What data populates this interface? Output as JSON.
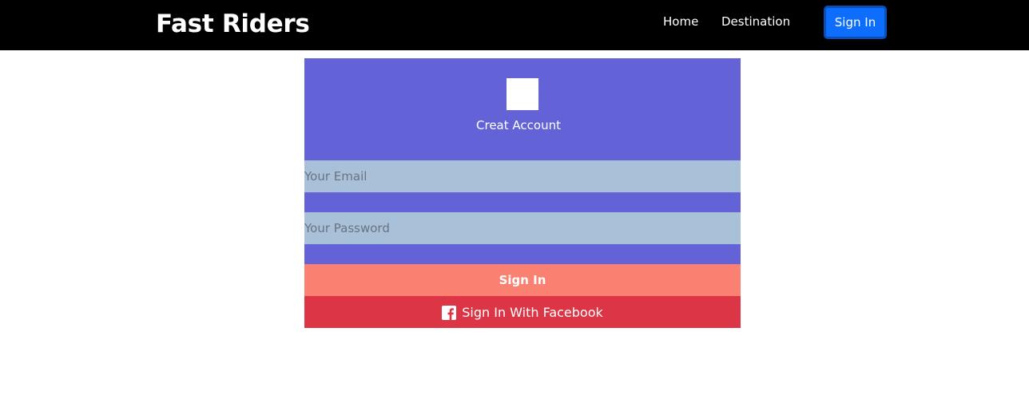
{
  "header": {
    "brand": "Fast Riders",
    "nav_home": "Home",
    "nav_destination": "Destination",
    "signin_label": "Sign In"
  },
  "form": {
    "title": "Creat Account",
    "email_placeholder": "Your Email",
    "password_placeholder": "Your Password",
    "signin_label": "Sign In",
    "facebook_label": "Sign In With Facebook"
  },
  "icons": {
    "facebook": "facebook-icon"
  },
  "colors": {
    "navbar_bg": "#000000",
    "accent_blue": "#0d6efd",
    "card_bg": "#6362d6",
    "input_bg": "#a8c1d9",
    "signin_bg": "#fa8172",
    "facebook_bg": "#dc3545"
  }
}
